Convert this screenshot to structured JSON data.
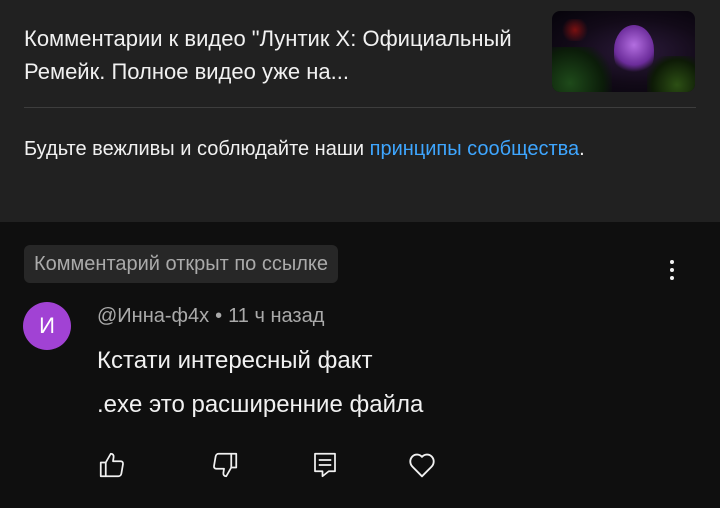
{
  "header": {
    "video_title": "Комментарии к видео \"Лунтик Х: Официальный Ремейк. Полное видео уже на...",
    "thumbnail_icon": "video-thumbnail",
    "guidelines_prefix": "Будьте вежливы и соблюдайте наши ",
    "guidelines_link": "принципы сообщества",
    "guidelines_suffix": "."
  },
  "comment": {
    "pill_label": "Комментарий открыт по ссылке",
    "avatar_letter": "И",
    "avatar_color": "#a142d4",
    "author": "@Инна-ф4х",
    "separator": "•",
    "time": "11 ч назад",
    "text_line1": "Кстати интересный факт",
    "text_line2": ".exe это расширенние файла",
    "actions": [
      "like-icon",
      "dislike-icon",
      "reply-icon",
      "heart-icon"
    ],
    "menu_icon": "more-vert-icon"
  },
  "colors": {
    "header_bg": "#212121",
    "page_bg": "#0f0f0f",
    "link": "#3ea6ff",
    "secondary_text": "#aaaaaa"
  }
}
